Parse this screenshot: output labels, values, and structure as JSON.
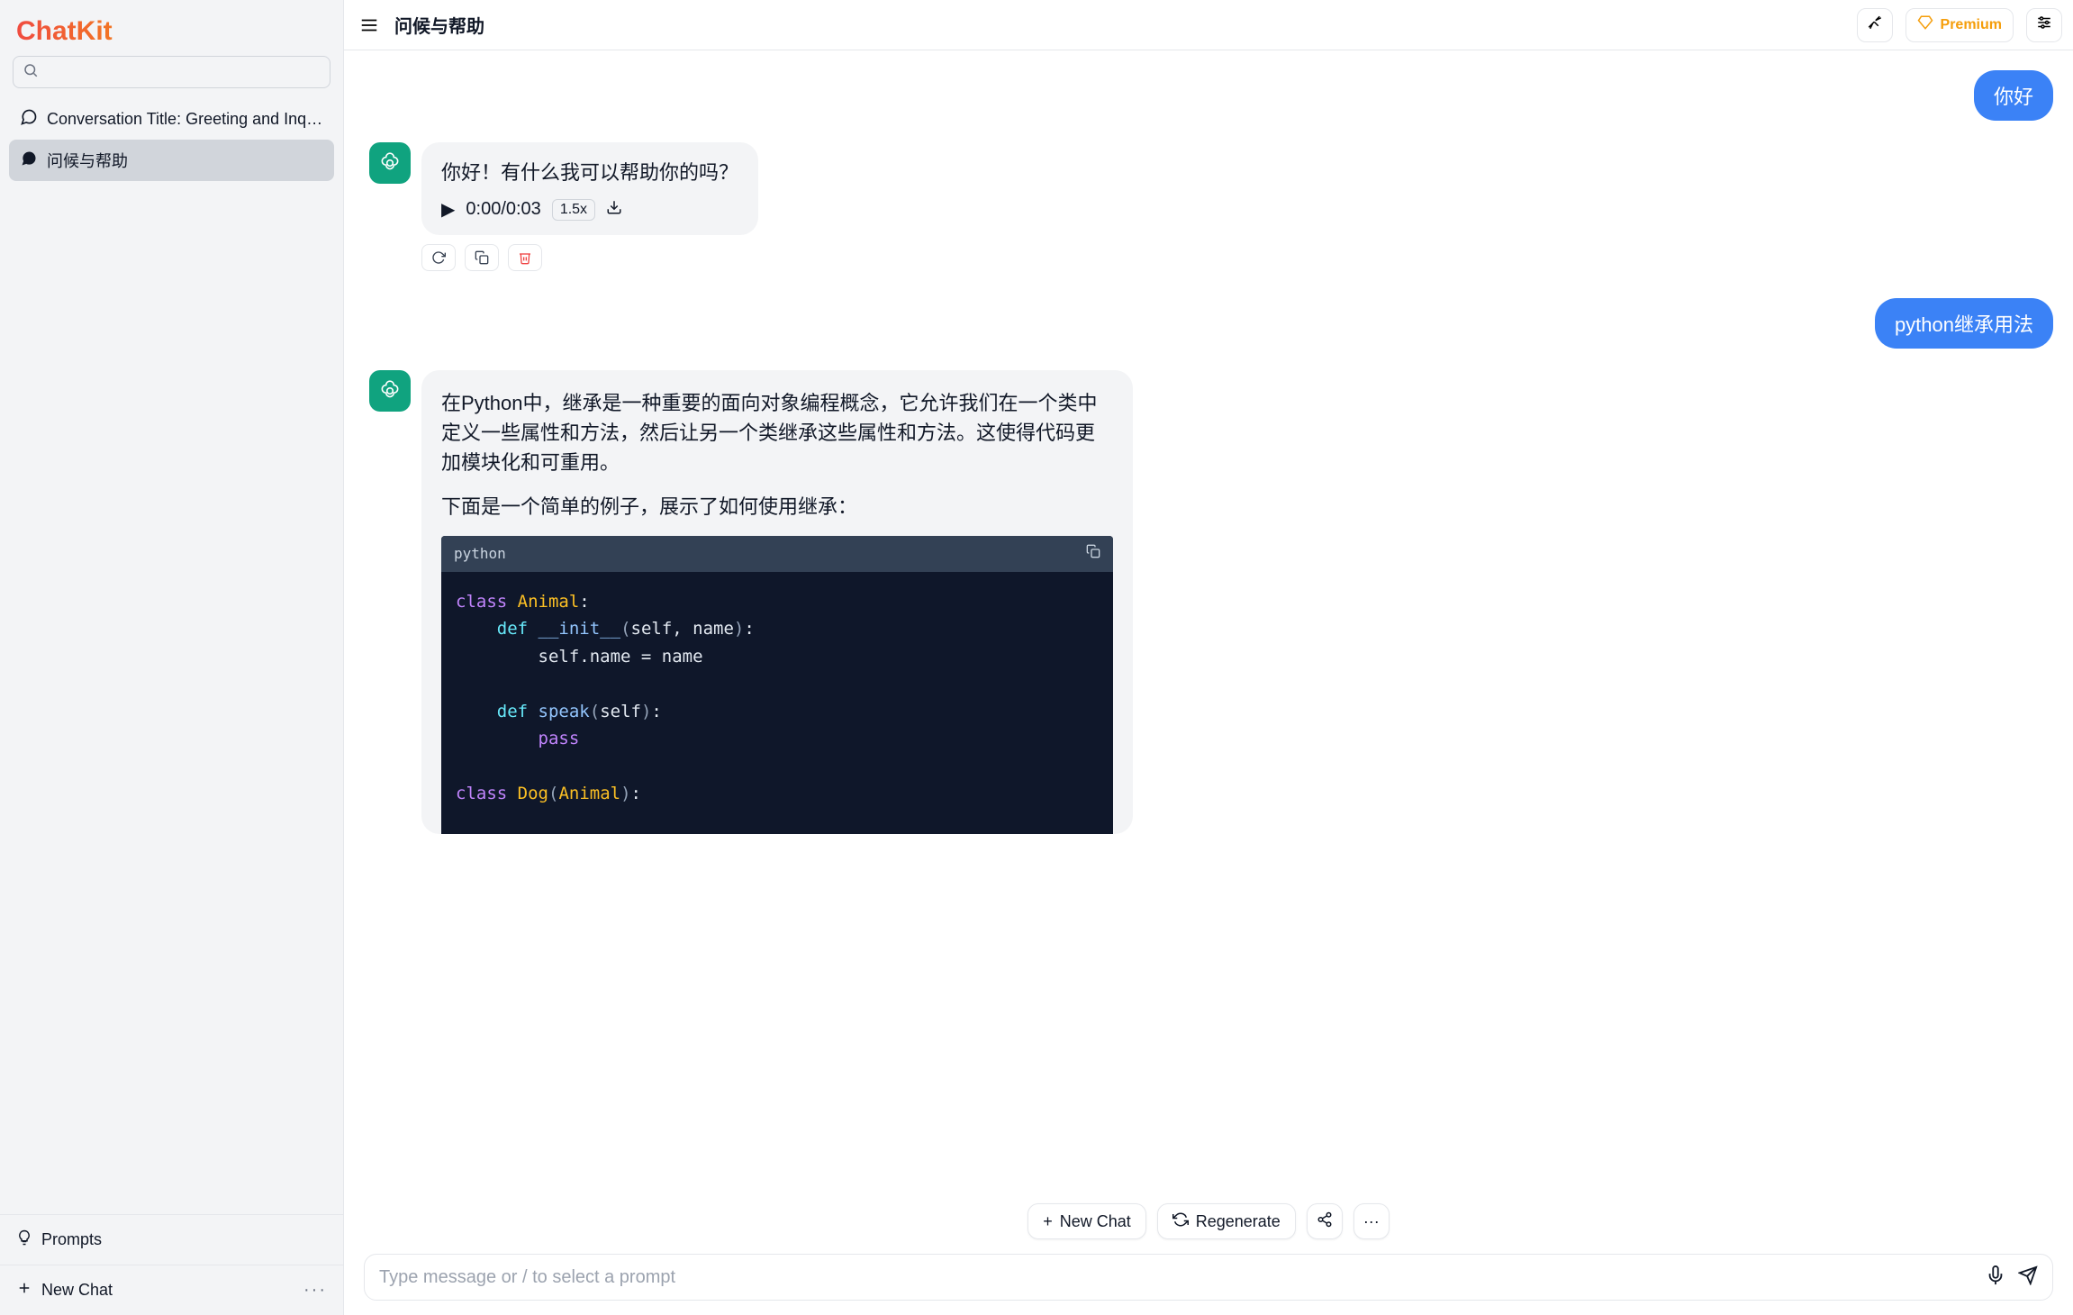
{
  "brand": "ChatKit",
  "search": {
    "placeholder": ""
  },
  "sidebar": {
    "items": [
      {
        "label": "Conversation Title: Greeting and Inquir…",
        "active": false
      },
      {
        "label": "问候与帮助",
        "active": true
      }
    ],
    "prompts_label": "Prompts",
    "newchat_label": "New Chat"
  },
  "topbar": {
    "title": "问候与帮助",
    "premium_label": "Premium"
  },
  "messages": {
    "user1": "你好",
    "assistant1": {
      "text": "你好！有什么我可以帮助你的吗？",
      "audio_time": "0:00/0:03",
      "speed": "1.5x"
    },
    "user2": "python继承用法",
    "assistant2": {
      "p1": "在Python中，继承是一种重要的面向对象编程概念，它允许我们在一个类中定义一些属性和方法，然后让另一个类继承这些属性和方法。这使得代码更加模块化和可重用。",
      "p2": "下面是一个简单的例子，展示了如何使用继承：",
      "code_lang": "python",
      "code": "class Animal:\n    def __init__(self, name):\n        self.name = name\n\n    def speak(self):\n        pass\n\nclass Dog(Animal):"
    }
  },
  "bottom_actions": {
    "new_chat": "New Chat",
    "regenerate": "Regenerate"
  },
  "composer": {
    "placeholder": "Type message or / to select a prompt"
  }
}
